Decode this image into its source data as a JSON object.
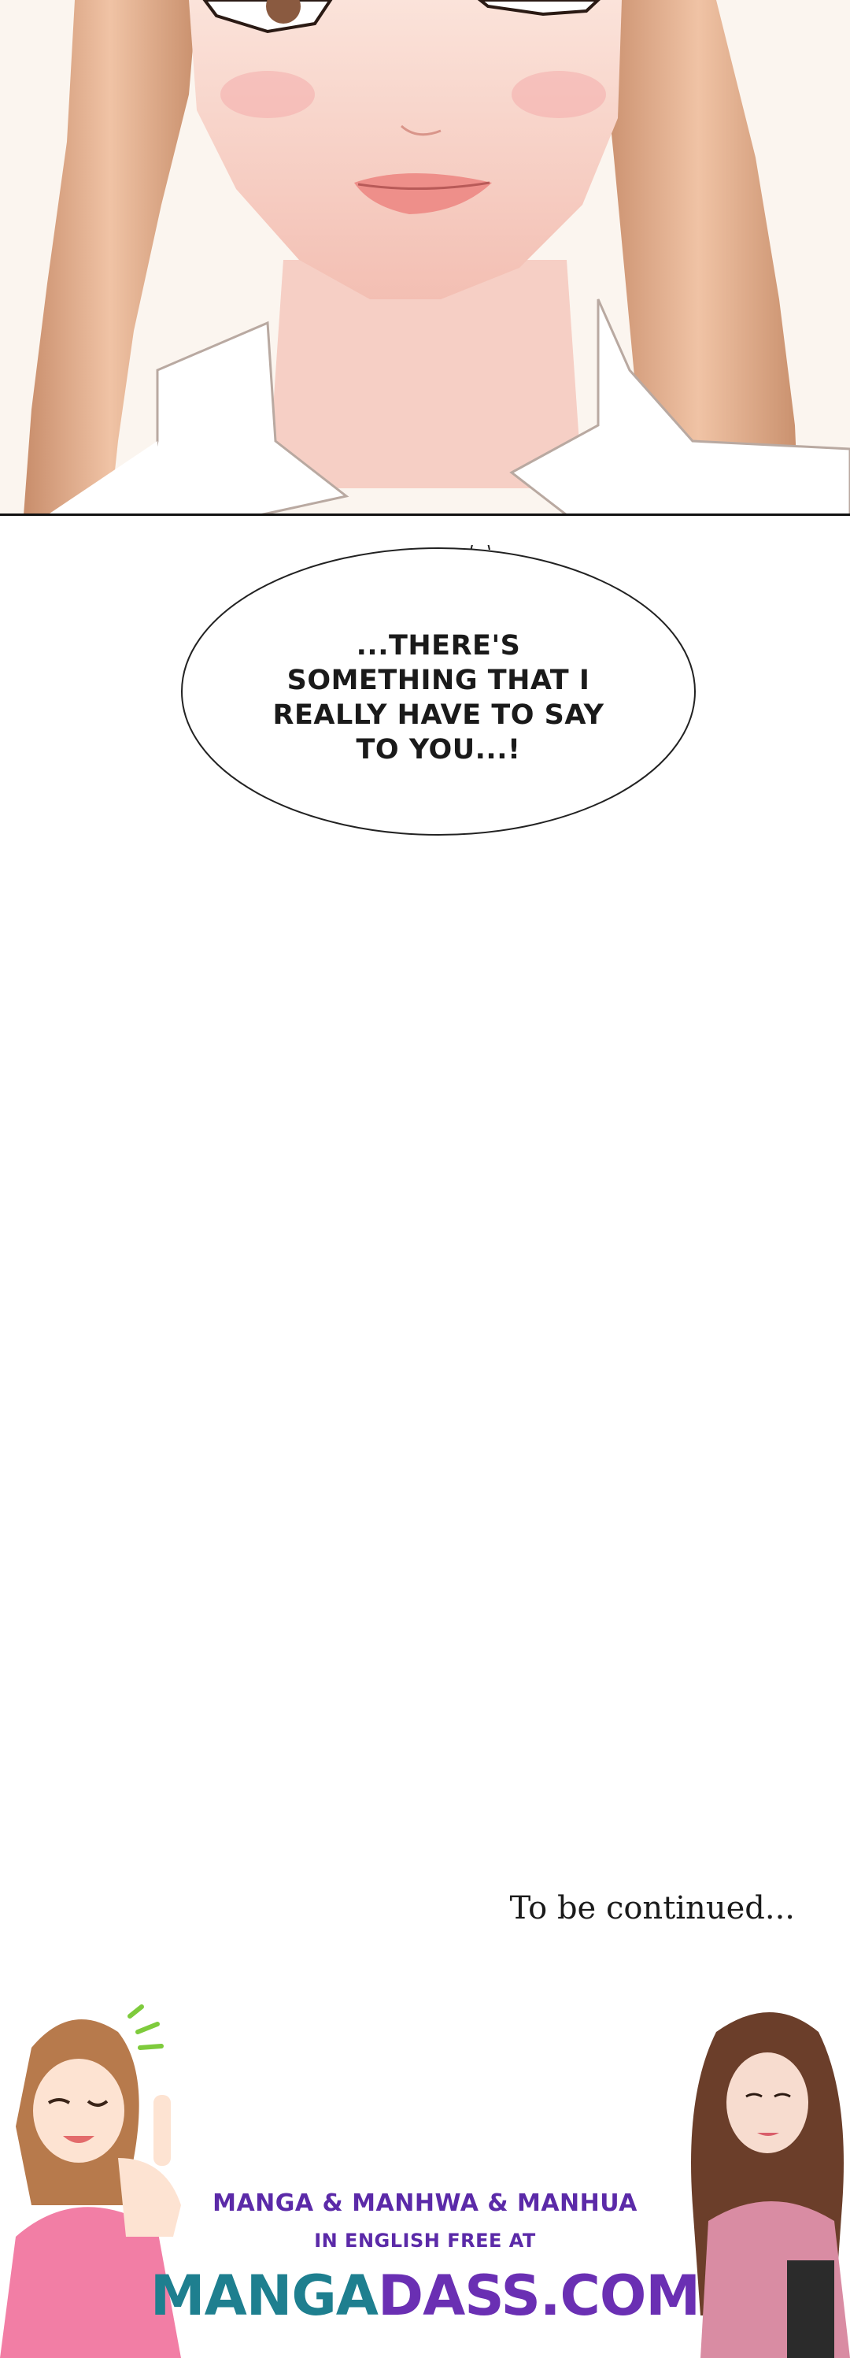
{
  "bubble": {
    "lines": [
      "...THERE'S",
      "SOMETHING THAT I",
      "REALLY HAVE TO SAY",
      "TO YOU...!"
    ]
  },
  "ending": {
    "to_be_continued": "To be continued..."
  },
  "promo": {
    "line1": "MANGA & MANHWA & MANHUA",
    "line2": "IN ENGLISH FREE AT",
    "brand_part1": "MANGA",
    "brand_part2": "DASS.COM"
  },
  "colors": {
    "promo_text": "#5b2aa8",
    "brand_teal": "#1e7f8f",
    "brand_purple": "#6a2fb3",
    "hair": "#d9a27f",
    "skin": "#f7d7cc"
  }
}
